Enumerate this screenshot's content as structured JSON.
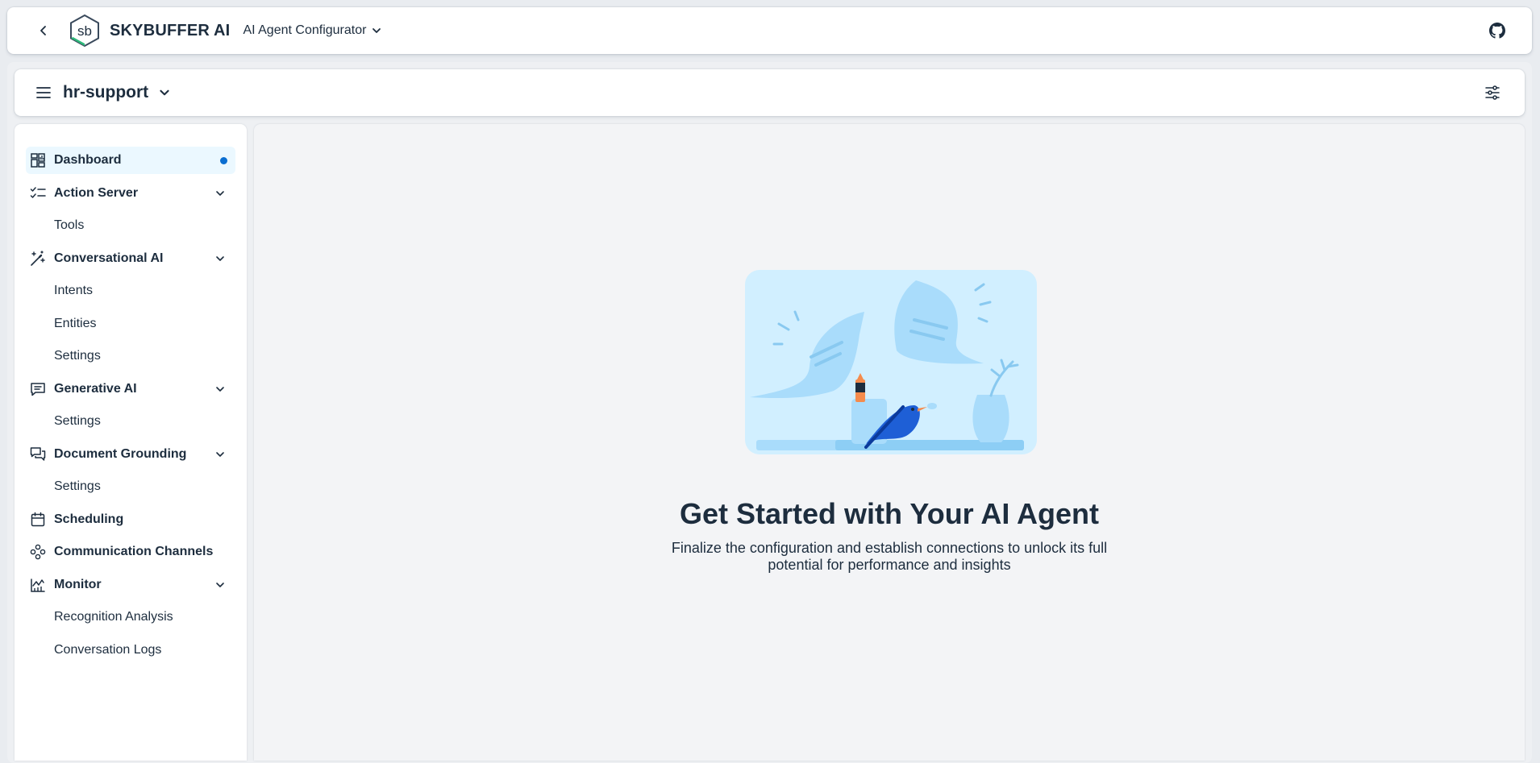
{
  "shell": {
    "brand": "SKYBUFFER AI",
    "logo_text": "sb",
    "product_menu_label": "AI Agent Configurator"
  },
  "subheader": {
    "workspace": "hr-support"
  },
  "sidebar": {
    "items": [
      {
        "label": "Dashboard",
        "icon": "dashboard-icon",
        "active": true
      },
      {
        "label": "Action Server",
        "icon": "checklist-icon",
        "expanded": true,
        "children": [
          "Tools"
        ]
      },
      {
        "label": "Conversational AI",
        "icon": "magic-wand-icon",
        "expanded": true,
        "children": [
          "Intents",
          "Entities",
          "Settings"
        ]
      },
      {
        "label": "Generative AI",
        "icon": "chat-icon",
        "expanded": true,
        "children": [
          "Settings"
        ]
      },
      {
        "label": "Document Grounding",
        "icon": "discussion-icon",
        "expanded": true,
        "children": [
          "Settings"
        ]
      },
      {
        "label": "Scheduling",
        "icon": "calendar-icon"
      },
      {
        "label": "Communication Channels",
        "icon": "network-icon"
      },
      {
        "label": "Monitor",
        "icon": "line-chart-icon",
        "expanded": true,
        "children": [
          "Recognition Analysis",
          "Conversation Logs"
        ]
      }
    ]
  },
  "main": {
    "title": "Get Started with Your AI Agent",
    "description": "Finalize the configuration and establish connections to unlock its full potential for performance and insights"
  },
  "colors": {
    "accent": "#0a6ed1",
    "active_bg": "#ebf8ff",
    "text": "#1d2d3e",
    "page_bg": "#f3f4f6"
  }
}
